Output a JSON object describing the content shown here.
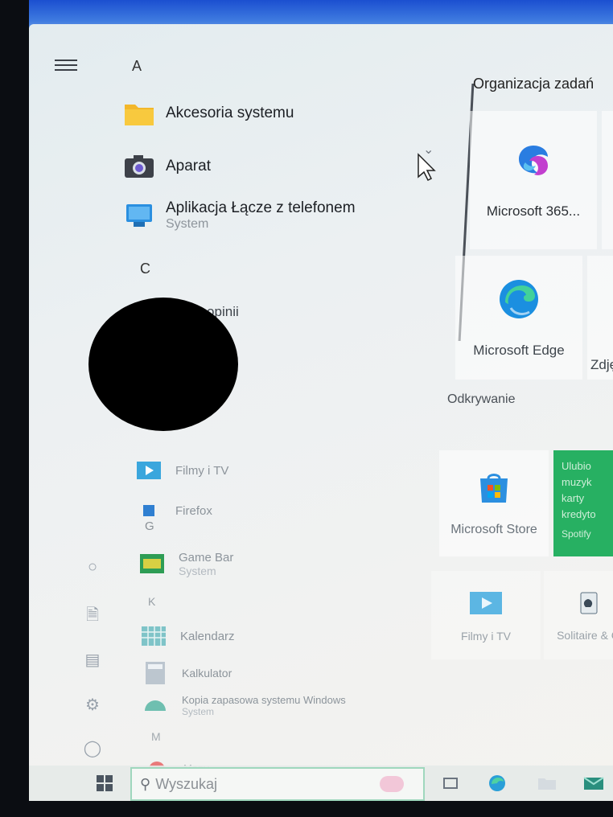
{
  "start_menu": {
    "letters": {
      "a": "A",
      "c": "C",
      "g": "G",
      "k": "K",
      "m": "M"
    },
    "apps": [
      {
        "name": "Akcesoria systemu",
        "icon": "folder-icon"
      },
      {
        "name": "Aparat",
        "icon": "camera-icon"
      },
      {
        "name": "Aplikacja Łącze z telefonem",
        "sub": "System",
        "icon": "phone-link-icon"
      },
      {
        "name": "...m opinii",
        "icon": "feedback-icon"
      },
      {
        "name": "Filmy i TV",
        "icon": "film-icon"
      },
      {
        "name": "Firefox",
        "icon": "firefox-icon"
      },
      {
        "name": "Game Bar",
        "sub": "System",
        "icon": "game-bar-icon"
      },
      {
        "name": "Kalendarz",
        "icon": "calendar-icon"
      },
      {
        "name": "Kalkulator",
        "icon": "calculator-icon"
      },
      {
        "name": "Kopia zapasowa systemu Windows",
        "sub": "System",
        "icon": "backup-icon"
      },
      {
        "name": "Mapy",
        "icon": "maps-icon"
      }
    ]
  },
  "tiles": {
    "group1_title": "Organizacja zadań",
    "group2_title": "Odkrywanie",
    "items": [
      {
        "label": "Microsoft 365...",
        "icon": "microsoft-365-icon"
      },
      {
        "label": "Microsoft Edge",
        "icon": "edge-icon"
      },
      {
        "label": "Zdję",
        "icon": "photos-icon"
      },
      {
        "label": "Microsoft Store",
        "icon": "store-icon"
      },
      {
        "label": "Filmy i TV",
        "icon": "film-icon"
      },
      {
        "label": "Solitaire & C",
        "icon": "solitaire-icon"
      }
    ],
    "spotify": {
      "line1": "Ulubio",
      "line2": "muzyk",
      "line3": "karty",
      "line4": "kredyto",
      "brand": "Spotify"
    }
  },
  "taskbar": {
    "search_placeholder": "Wyszukaj"
  },
  "colors": {
    "accent_blue": "#1b4fd0",
    "spotify_green": "#27b062",
    "search_border": "#9fd7bd"
  }
}
